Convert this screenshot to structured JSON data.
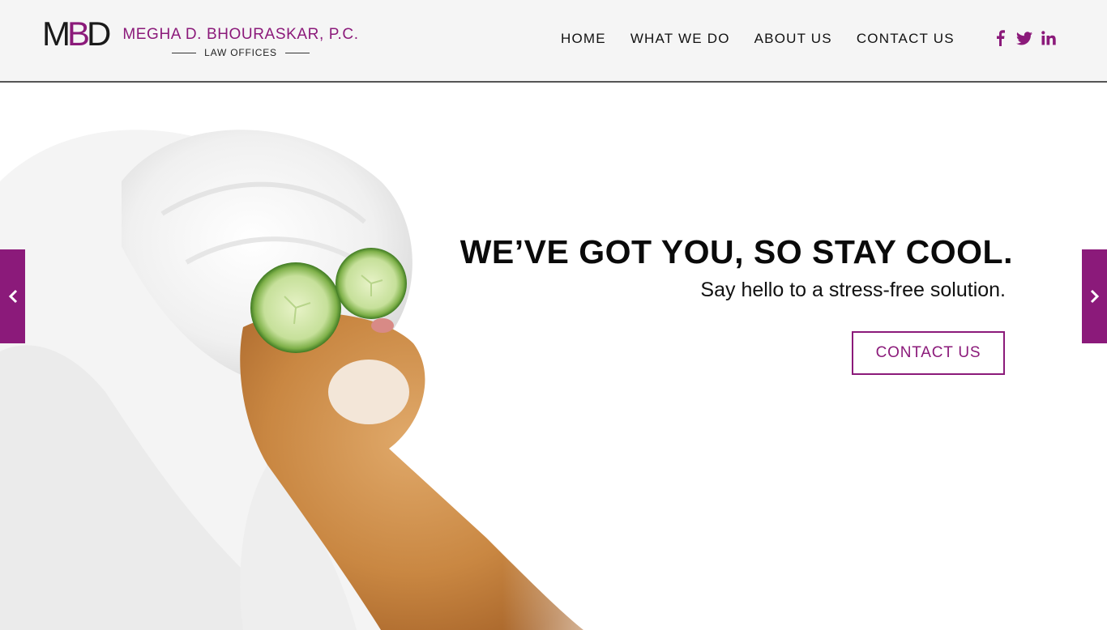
{
  "brand": {
    "monogram": [
      "M",
      "B",
      "D"
    ],
    "name": "MEGHA D. BHOURASKAR, P.C.",
    "tagline": "LAW OFFICES",
    "accent_color": "#8b1a7a"
  },
  "nav": {
    "items": [
      {
        "label": "HOME"
      },
      {
        "label": "WHAT WE DO"
      },
      {
        "label": "ABOUT US"
      },
      {
        "label": "CONTACT US"
      }
    ]
  },
  "social": {
    "icons": [
      "facebook-icon",
      "twitter-icon",
      "linkedin-icon"
    ]
  },
  "hero": {
    "headline": "WE’VE GOT YOU, SO STAY COOL.",
    "subheadline": "Say hello to a stress-free solution.",
    "cta_label": "CONTACT US",
    "prev_icon": "chevron-left-icon",
    "next_icon": "chevron-right-icon"
  }
}
